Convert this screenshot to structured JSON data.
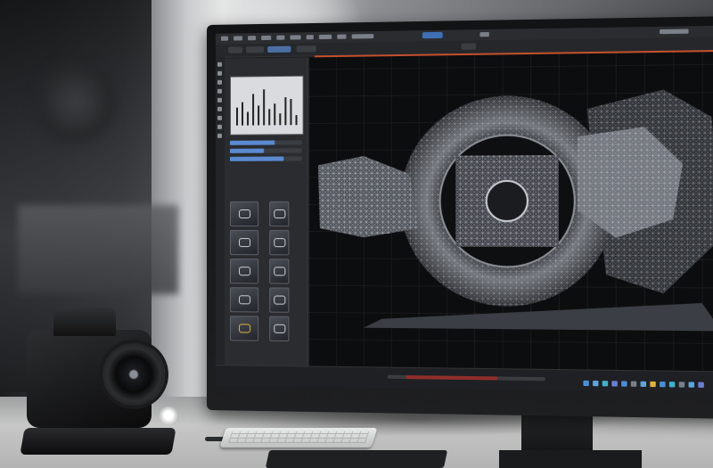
{
  "scene": {
    "description_kind": "photo",
    "colors": {
      "accent_blue": "#4c6fa3",
      "accent_orange": "#c2502c",
      "viewport_bg": "#0c0d0f",
      "wire": "#d6d9de",
      "timeline_red": "#8f2f2a",
      "gold": "#e2b13a"
    }
  },
  "ui": {
    "panel_title": "",
    "graph_bars": [
      0.45,
      0.6,
      0.35,
      0.8,
      0.5,
      0.9,
      0.4,
      0.55,
      0.3,
      0.7,
      0.65,
      0.25
    ],
    "sliders": [
      {
        "label": "",
        "value": 0.62
      },
      {
        "label": "",
        "value": 0.48
      },
      {
        "label": "",
        "value": 0.75
      }
    ],
    "thumbnail_icons": [
      "model-icon",
      "ring-icon",
      "shape-icon",
      "ring-icon",
      "gear-icon",
      "model-icon",
      "ring-icon",
      "model-icon",
      "gold-ring-icon",
      "model-icon"
    ],
    "timeline_progress": 0.7
  }
}
